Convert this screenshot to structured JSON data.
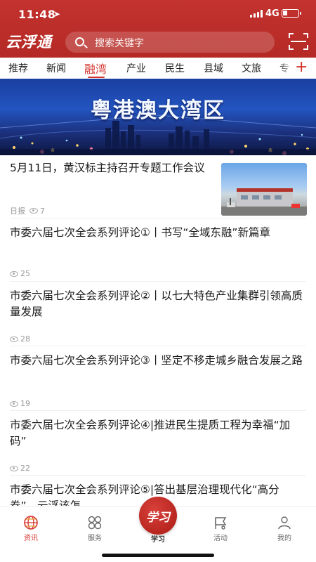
{
  "status": {
    "time": "11:48",
    "network": "4G",
    "battery_level": 0.3
  },
  "header": {
    "logo": "云浮通",
    "search_placeholder": "搜索关键字",
    "scan_icon": "scan-icon"
  },
  "tabs": [
    {
      "label": "推荐"
    },
    {
      "label": "新闻"
    },
    {
      "label": "融湾",
      "active": true
    },
    {
      "label": "产业"
    },
    {
      "label": "民生"
    },
    {
      "label": "县域"
    },
    {
      "label": "文旅"
    },
    {
      "label": "专"
    }
  ],
  "add_tab": "+",
  "banner": {
    "title": "粤港澳大湾区"
  },
  "news": [
    {
      "title": "5月11日，黄汉标主持召开专题工作会议",
      "source": "日报",
      "views": "7",
      "has_thumb": true
    },
    {
      "title": "市委六届七次全会系列评论①丨书写“全域东融”新篇章",
      "views": "25"
    },
    {
      "title": "市委六届七次全会系列评论②丨以七大特色产业集群引领高质量发展",
      "views": "28"
    },
    {
      "title": "市委六届七次全会系列评论③丨坚定不移走城乡融合发展之路",
      "views": "19"
    },
    {
      "title": "市委六届七次全会系列评论④|推进民生提质工程为幸福“加码”",
      "views": "22"
    },
    {
      "title": "市委六届七次全会系列评论⑤|答出基层治理现代化“高分卷”，云浮该怎"
    }
  ],
  "bottom_nav": {
    "news": "资讯",
    "service": "服务",
    "study": "学习",
    "study_mark": "学习",
    "activity": "活动",
    "mine": "我的"
  },
  "colors": {
    "brand_red": "#c3322e",
    "accent_red": "#d4332e"
  }
}
